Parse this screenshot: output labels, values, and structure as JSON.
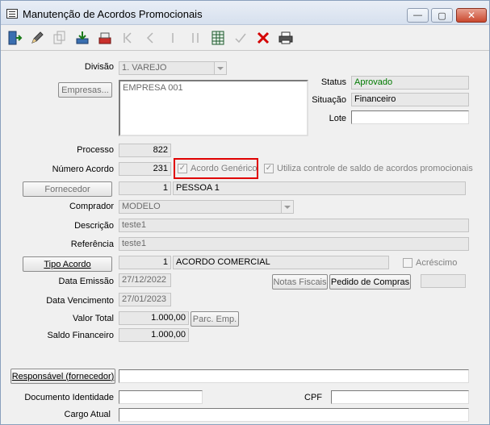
{
  "window": {
    "title": "Manutenção de Acordos Promocionais",
    "min_label": "—",
    "max_label": "▢",
    "close_label": "✕"
  },
  "toolbar": {
    "items": [
      {
        "icon": "exit-door-icon",
        "enabled": true
      },
      {
        "icon": "edit-pencil-icon",
        "enabled": true
      },
      {
        "icon": "copy-icon",
        "enabled": false
      },
      {
        "icon": "import-icon",
        "enabled": true
      },
      {
        "icon": "save-icon",
        "enabled": true
      },
      {
        "icon": "first-record-icon",
        "enabled": false
      },
      {
        "icon": "previous-record-icon",
        "enabled": false
      },
      {
        "icon": "next-record-icon",
        "enabled": false
      },
      {
        "icon": "last-record-icon",
        "enabled": false
      },
      {
        "icon": "grid-view-icon",
        "enabled": true
      },
      {
        "icon": "validate-icon",
        "enabled": false
      },
      {
        "icon": "delete-x-icon",
        "enabled": true
      },
      {
        "icon": "print-icon",
        "enabled": true
      }
    ]
  },
  "form": {
    "divisao_label": "Divisão",
    "divisao_value": "1. VAREJO",
    "empresas_button": "Empresas...",
    "empresas_list": [
      "EMPRESA 001"
    ],
    "status_label": "Status",
    "status_value": "Aprovado",
    "situacao_label": "Situação",
    "situacao_value": "Financeiro",
    "lote_label": "Lote",
    "lote_value": "",
    "processo_label": "Processo",
    "processo_value": "822",
    "numero_acordo_label": "Número Acordo",
    "numero_acordo_value": "231",
    "acordo_generico_label": "Acordo Genérico",
    "utiliza_controle_label": "Utiliza controle de saldo de acordos promocionais",
    "fornecedor_button": "Fornecedor",
    "fornecedor_code": "1",
    "fornecedor_name": "PESSOA 1",
    "comprador_label": "Comprador",
    "comprador_value": "MODELO",
    "descricao_label": "Descrição",
    "descricao_value": "teste1",
    "referencia_label": "Referência",
    "referencia_value": "teste1",
    "tipo_acordo_button": "Tipo Acordo",
    "tipo_acordo_code": "1",
    "tipo_acordo_name": "ACORDO COMERCIAL",
    "acrescimo_label": "Acréscimo",
    "data_emissao_label": "Data Emissão",
    "data_emissao_value": "27/12/2022",
    "notas_fiscais_button": "Notas Fiscais",
    "pedido_compras_button": "Pedido de Compras",
    "data_vencimento_label": "Data Vencimento",
    "data_vencimento_value": "27/01/2023",
    "valor_total_label": "Valor Total",
    "valor_total_value": "1.000,00",
    "parc_emp_button": "Parc. Emp.",
    "saldo_financeiro_label": "Saldo Financeiro",
    "saldo_financeiro_value": "1.000,00",
    "responsavel_button": "Responsável (fornecedor)",
    "responsavel_value": "",
    "documento_label": "Documento Identidade",
    "documento_value": "",
    "cpf_label": "CPF",
    "cpf_value": "",
    "cargo_label": "Cargo Atual",
    "cargo_value": ""
  }
}
